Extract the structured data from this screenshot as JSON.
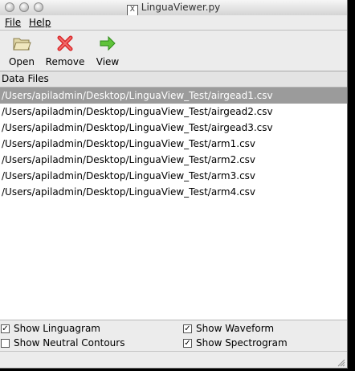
{
  "window": {
    "title": "LinguaViewer.py"
  },
  "menu": {
    "file": "File",
    "help": "Help"
  },
  "toolbar": {
    "open": "Open",
    "remove": "Remove",
    "view": "View"
  },
  "section": {
    "data_files": "Data Files"
  },
  "files": [
    "/Users/apiladmin/Desktop/LinguaView_Test/airgead1.csv",
    "/Users/apiladmin/Desktop/LinguaView_Test/airgead2.csv",
    "/Users/apiladmin/Desktop/LinguaView_Test/airgead3.csv",
    "/Users/apiladmin/Desktop/LinguaView_Test/arm1.csv",
    "/Users/apiladmin/Desktop/LinguaView_Test/arm2.csv",
    "/Users/apiladmin/Desktop/LinguaView_Test/arm3.csv",
    "/Users/apiladmin/Desktop/LinguaView_Test/arm4.csv"
  ],
  "selected_file_index": 0,
  "options": {
    "show_linguagram": {
      "label": "Show Linguagram",
      "checked": true
    },
    "show_neutral_contours": {
      "label": "Show Neutral Contours",
      "checked": false
    },
    "show_waveform": {
      "label": "Show Waveform",
      "checked": true
    },
    "show_spectrogram": {
      "label": "Show Spectrogram",
      "checked": true
    }
  },
  "colors": {
    "selection": "#9b9b9b",
    "window_bg": "#ececec"
  }
}
